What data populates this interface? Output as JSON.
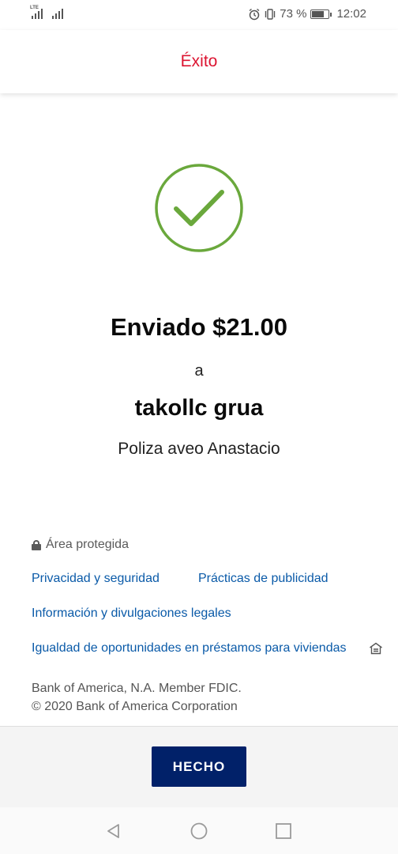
{
  "status_bar": {
    "network_label": "LTE",
    "battery_percent": "73 %",
    "battery_level": 0.73,
    "time": "12:02"
  },
  "header": {
    "title": "Éxito"
  },
  "confirmation": {
    "amount_text": "Enviado $21.00",
    "connector": "a",
    "recipient": "takollc grua",
    "memo": "Poliza aveo Anastacio"
  },
  "footer_info": {
    "secure_label": "Área protegida",
    "links": [
      "Privacidad y seguridad",
      "Prácticas de publicidad",
      "Información y divulgaciones legales",
      "Igualdad de oportunidades en préstamos para viviendas"
    ],
    "legal_line1": "Bank of America, N.A. Member FDIC.",
    "legal_line2": "© 2020 Bank of America Corporation"
  },
  "actions": {
    "done_label": "HECHO"
  },
  "colors": {
    "title_red": "#dc1431",
    "check_green": "#6aa83c",
    "link_blue": "#0a5aa8",
    "button_navy": "#012169"
  },
  "icons": [
    "lock-icon",
    "equal-housing-lender-icon",
    "alarm-icon",
    "vibrate-icon",
    "battery-icon",
    "back-nav-icon",
    "home-nav-icon",
    "recents-nav-icon"
  ]
}
